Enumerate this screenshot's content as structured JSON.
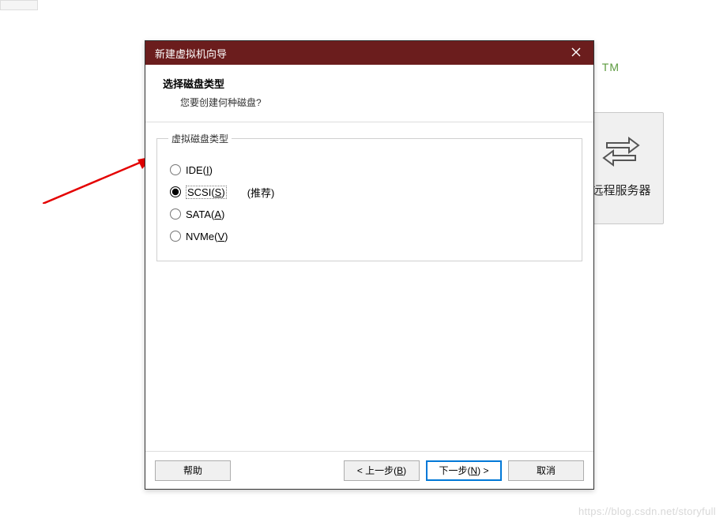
{
  "topmark": "TM",
  "remote_panel": {
    "label": "远程服务器"
  },
  "dialog": {
    "title": "新建虚拟机向导",
    "heading": "选择磁盘类型",
    "subheading": "您要创建何种磁盘?",
    "group_label": "虚拟磁盘类型",
    "options": {
      "ide": {
        "label_prefix": "IDE(",
        "mnemonic": "I",
        "label_suffix": ")"
      },
      "scsi": {
        "label_prefix": "SCSI(",
        "mnemonic": "S",
        "label_suffix": ")",
        "hint": "(推荐)",
        "selected": true
      },
      "sata": {
        "label_prefix": "SATA(",
        "mnemonic": "A",
        "label_suffix": ")"
      },
      "nvme": {
        "label_prefix": "NVMe(",
        "mnemonic": "V",
        "label_suffix": ")"
      }
    },
    "buttons": {
      "help": "帮助",
      "back_prefix": "< 上一步(",
      "back_mnemonic": "B",
      "back_suffix": ")",
      "next_prefix": "下一步(",
      "next_mnemonic": "N",
      "next_suffix": ") >",
      "cancel": "取消"
    }
  },
  "watermark": "https://blog.csdn.net/storyfull"
}
